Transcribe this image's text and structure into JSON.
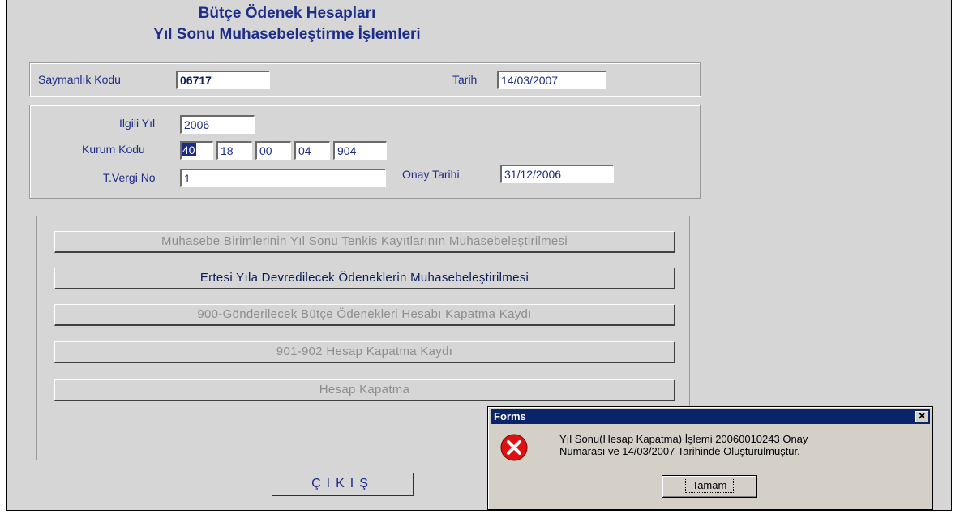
{
  "form": {
    "title_line1": "Bütçe Ödenek Hesapları",
    "title_line2": "Yıl Sonu Muhasebeleştirme İşlemleri"
  },
  "header": {
    "saymanlik_label": "Saymanlık Kodu",
    "saymanlik_value": "06717",
    "tarih_label": "Tarih",
    "tarih_value": "14/03/2007"
  },
  "details": {
    "ilgili_yil_label": "İlgili Yıl",
    "ilgili_yil_value": "2006",
    "kurum_kodu_label": "Kurum Kodu",
    "kurum_kodu_parts": [
      "40",
      "18",
      "00",
      "04",
      "904"
    ],
    "vergi_no_label": "T.Vergi No",
    "vergi_no_value": "1",
    "onay_tarihi_label": "Onay Tarihi",
    "onay_tarihi_value": "31/12/2006"
  },
  "actions": [
    {
      "label": "Muhasebe Birimlerinin Yıl Sonu Tenkis Kayıtlarının Muhasebeleştirilmesi",
      "enabled": false
    },
    {
      "label": "Ertesi Yıla Devredilecek Ödeneklerin Muhasebeleştirilmesi",
      "enabled": true
    },
    {
      "label": "900-Gönderilecek Bütçe Ödenekleri Hesabı Kapatma Kaydı",
      "enabled": false
    },
    {
      "label": "901-902 Hesap Kapatma Kaydı",
      "enabled": false
    },
    {
      "label": "Hesap Kapatma",
      "enabled": false
    }
  ],
  "exit_label": "ÇIKIŞ",
  "dialog": {
    "title": "Forms",
    "close_glyph": "✕",
    "icon": "error-icon",
    "message_line1": "Yıl Sonu(Hesap Kapatma) İşlemi 20060010243 Onay",
    "message_line2": "Numarası ve 14/03/2007 Tarihinde Oluşturulmuştur.",
    "ok_label": "Tamam"
  },
  "colors": {
    "label_text": "#1d2d8a",
    "disabled_text": "#8e8e8e",
    "dialog_titlebar": "#0a246a",
    "error_red": "#e01010"
  }
}
